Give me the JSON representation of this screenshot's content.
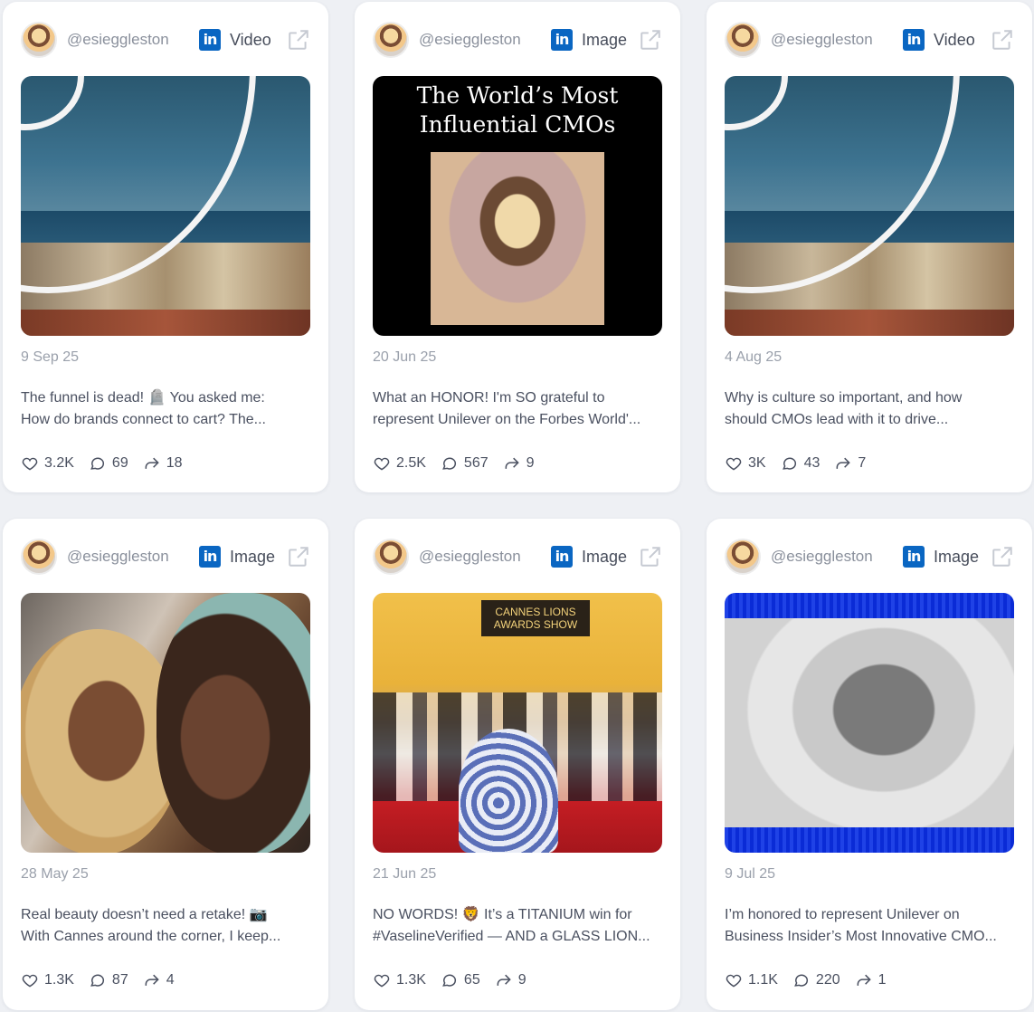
{
  "cards": [
    {
      "handle": "@esieggleston",
      "platform_icon": "linkedin-icon",
      "type": "Video",
      "date": "9 Sep 25",
      "caption_line1": "The funnel is dead! 🪦 You asked me:",
      "caption_line2": "How do brands connect to cart? The...",
      "likes": "3.2K",
      "comments": "69",
      "shares": "18"
    },
    {
      "handle": "@esieggleston",
      "platform_icon": "linkedin-icon",
      "type": "Image",
      "media_title_line1": "The World’s Most",
      "media_title_line2": "Influential CMOs",
      "date": "20 Jun 25",
      "caption_line1": "What an HONOR! I'm SO grateful to",
      "caption_line2": "represent Unilever on the Forbes World'...",
      "likes": "2.5K",
      "comments": "567",
      "shares": "9"
    },
    {
      "handle": "@esieggleston",
      "platform_icon": "linkedin-icon",
      "type": "Video",
      "date": "4 Aug 25",
      "caption_line1": "Why is culture so important, and how",
      "caption_line2": "should CMOs lead with it to drive...",
      "likes": "3K",
      "comments": "43",
      "shares": "7"
    },
    {
      "handle": "@esieggleston",
      "platform_icon": "linkedin-icon",
      "type": "Image",
      "date": "28 May 25",
      "caption_line1": "Real beauty doesn’t need a retake! 📷",
      "caption_line2": "With Cannes around the corner, I keep...",
      "likes": "1.3K",
      "comments": "87",
      "shares": "4"
    },
    {
      "handle": "@esieggleston",
      "platform_icon": "linkedin-icon",
      "type": "Image",
      "media_sign": "CANNES LIONS AWARDS SHOW",
      "date": "21 Jun 25",
      "caption_line1": "NO WORDS! 🦁 It’s a TITANIUM win for",
      "caption_line2": "#VaselineVerified — AND a GLASS LION...",
      "likes": "1.3K",
      "comments": "65",
      "shares": "9"
    },
    {
      "handle": "@esieggleston",
      "platform_icon": "linkedin-icon",
      "type": "Image",
      "date": "9 Jul 25",
      "caption_line1": "I’m honored to represent Unilever on",
      "caption_line2": "Business Insider’s Most Innovative CMO...",
      "likes": "1.1K",
      "comments": "220",
      "shares": "1"
    }
  ],
  "linkedin_badge": "in",
  "colors": {
    "linkedin": "#0a66c2",
    "page_bg": "#eef0f4",
    "card_bg": "#ffffff",
    "muted": "#9aa0ab"
  }
}
